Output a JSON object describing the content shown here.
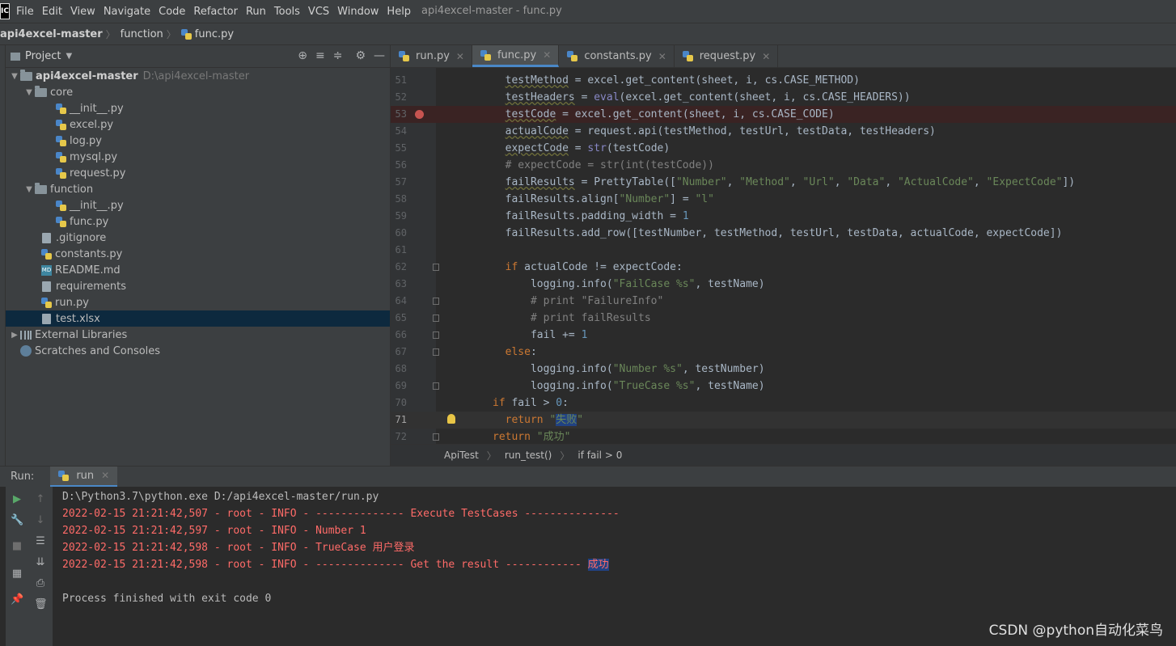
{
  "menubar": {
    "logo": "IC",
    "items": [
      "File",
      "Edit",
      "View",
      "Navigate",
      "Code",
      "Refactor",
      "Run",
      "Tools",
      "VCS",
      "Window",
      "Help"
    ],
    "window_title": "api4excel-master - func.py"
  },
  "navbar": {
    "crumbs": [
      "api4excel-master",
      "function",
      "func.py"
    ]
  },
  "project": {
    "title": "Project",
    "tree": [
      {
        "label": "api4excel-master",
        "path": "D:\\api4excel-master"
      },
      {
        "label": "core"
      },
      {
        "label": "__init__.py"
      },
      {
        "label": "excel.py"
      },
      {
        "label": "log.py"
      },
      {
        "label": "mysql.py"
      },
      {
        "label": "request.py"
      },
      {
        "label": "function"
      },
      {
        "label": "__init__.py"
      },
      {
        "label": "func.py"
      },
      {
        "label": ".gitignore"
      },
      {
        "label": "constants.py"
      },
      {
        "label": "README.md"
      },
      {
        "label": "requirements"
      },
      {
        "label": "run.py"
      },
      {
        "label": "test.xlsx"
      },
      {
        "label": "External Libraries"
      },
      {
        "label": "Scratches and Consoles"
      }
    ]
  },
  "editor": {
    "tabs": [
      "run.py",
      "func.py",
      "constants.py",
      "request.py"
    ],
    "active_tab": "func.py",
    "line_numbers": [
      "51",
      "52",
      "53",
      "54",
      "55",
      "56",
      "57",
      "58",
      "59",
      "60",
      "61",
      "62",
      "63",
      "64",
      "65",
      "66",
      "67",
      "68",
      "69",
      "70",
      "71",
      "72"
    ],
    "breadcrumb": [
      "ApiTest",
      "run_test()",
      "if fail > 0"
    ]
  },
  "run": {
    "label": "Run:",
    "tab": "run",
    "console": [
      "D:\\Python3.7\\python.exe D:/api4excel-master/run.py",
      "2022-02-15 21:21:42,507 - root - INFO - -------------- Execute TestCases ---------------",
      "2022-02-15 21:21:42,597 - root - INFO - Number 1",
      "2022-02-15 21:21:42,598 - root - INFO - TrueCase 用户登录",
      "2022-02-15 21:21:42,598 - root - INFO - -------------- Get the result ------------ ",
      "成功",
      "Process finished with exit code 0"
    ]
  },
  "watermark": "CSDN @python自动化菜鸟"
}
